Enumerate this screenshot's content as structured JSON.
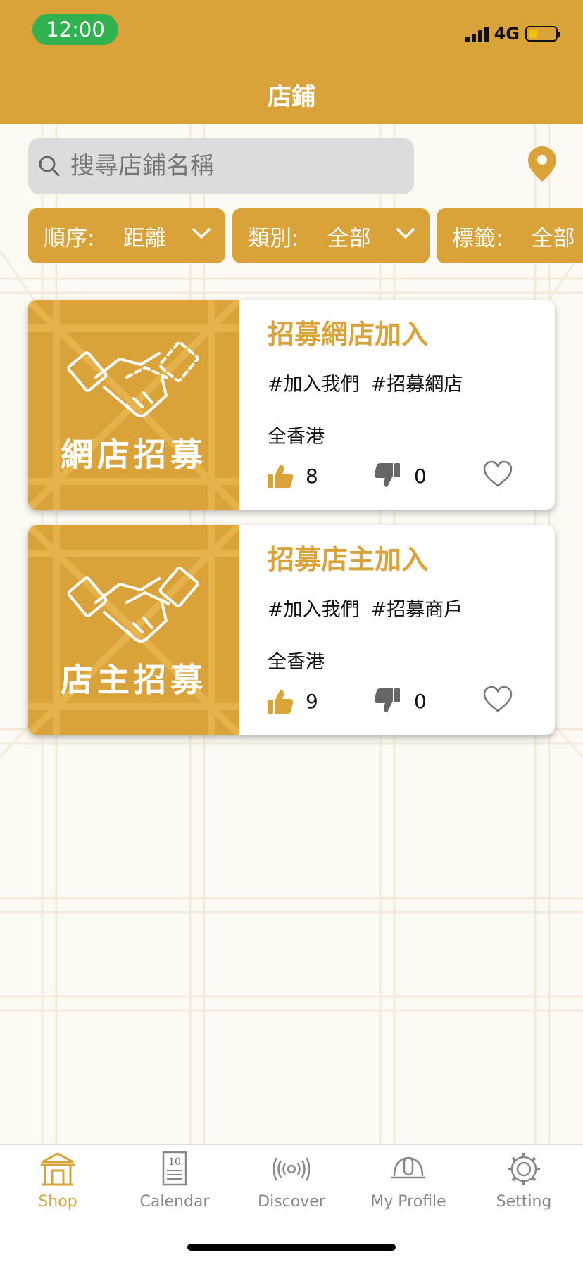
{
  "status_bar": {
    "time": "12:00",
    "network": "4G"
  },
  "header": {
    "title": "店鋪"
  },
  "search": {
    "placeholder": "搜尋店鋪名稱",
    "icon": "search-icon"
  },
  "location_icon": "location-pin-icon",
  "filters": [
    {
      "label": "順序:",
      "value": "距離"
    },
    {
      "label": "類別:",
      "value": "全部"
    },
    {
      "label": "標籤:",
      "value": "全部"
    }
  ],
  "cards": [
    {
      "thumb_text": "網店招募",
      "name": "招募網店加入",
      "tags": [
        "#加入我們",
        "#招募網店"
      ],
      "area": "全香港",
      "likes": "8",
      "dislikes": "0"
    },
    {
      "thumb_text": "店主招募",
      "name": "招募店主加入",
      "tags": [
        "#加入我們",
        "#招募商戶"
      ],
      "area": "全香港",
      "likes": "9",
      "dislikes": "0"
    }
  ],
  "tabs": [
    {
      "label": "Shop",
      "icon": "shop-icon",
      "active": true
    },
    {
      "label": "Calendar",
      "icon": "calendar-icon",
      "badge": "10"
    },
    {
      "label": "Discover",
      "icon": "discover-icon"
    },
    {
      "label": "My Profile",
      "icon": "profile-helmet-icon"
    },
    {
      "label": "Setting",
      "icon": "gear-icon"
    }
  ],
  "colors": {
    "accent": "#d9a33a",
    "background": "#fdfaf3",
    "time_pill": "#2fb24f"
  }
}
